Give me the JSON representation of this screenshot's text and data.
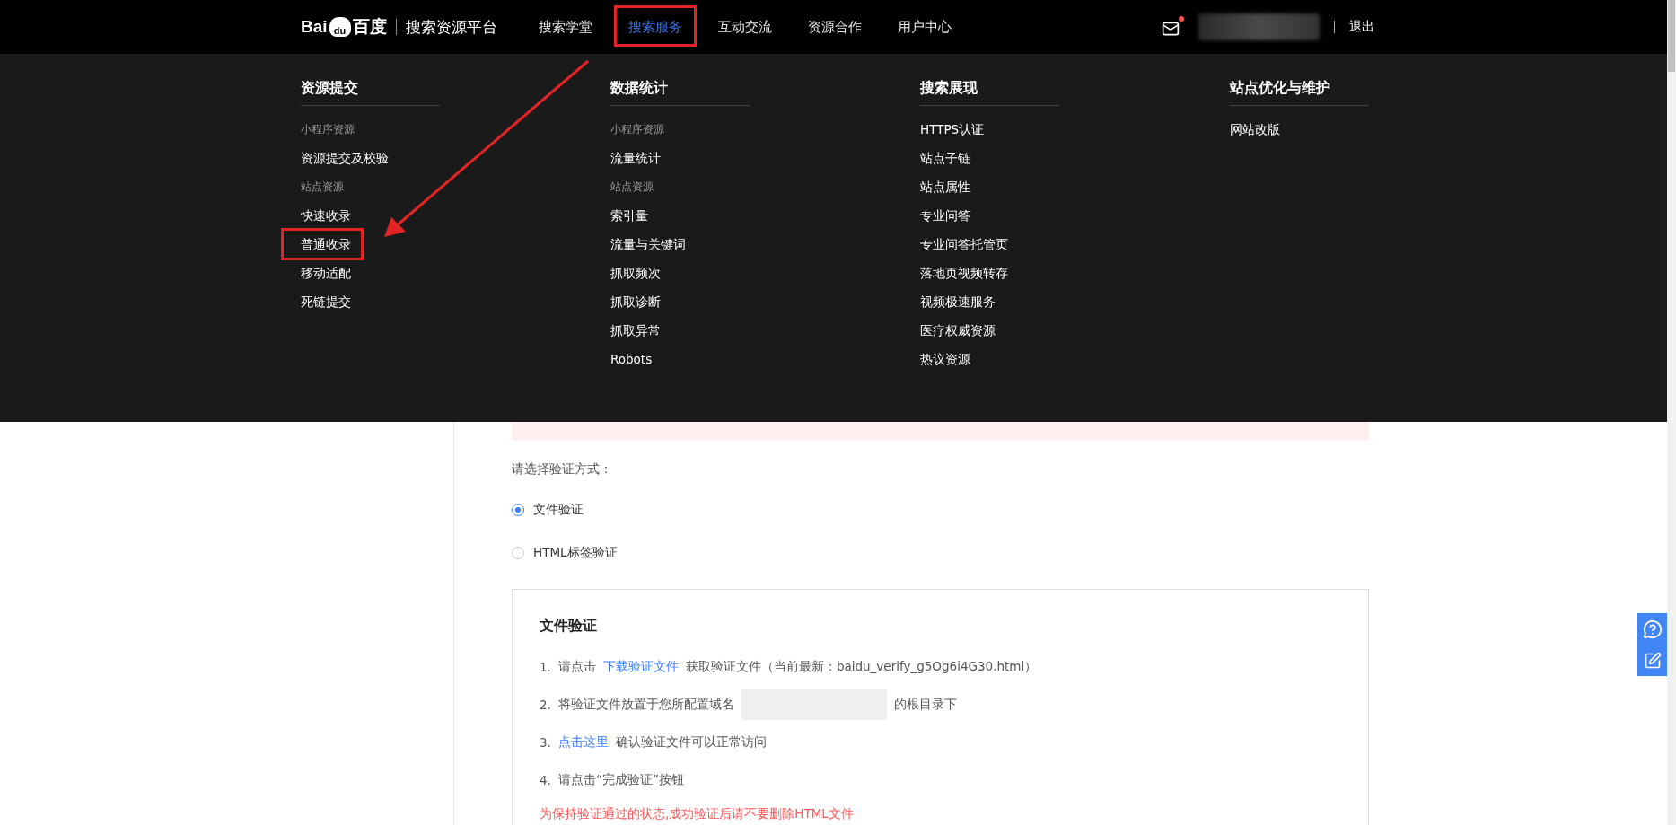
{
  "header": {
    "logo": {
      "left": "Bai",
      "paw": "du",
      "right": "百度"
    },
    "platform": "搜索资源平台",
    "nav": [
      {
        "label": "搜索学堂",
        "selected": false,
        "highlighted": false
      },
      {
        "label": "搜索服务",
        "selected": true,
        "highlighted": true
      },
      {
        "label": "互动交流",
        "selected": false,
        "highlighted": false
      },
      {
        "label": "资源合作",
        "selected": false,
        "highlighted": false
      },
      {
        "label": "用户中心",
        "selected": false,
        "highlighted": false
      }
    ],
    "mail_unread": true,
    "user_redacted": true,
    "logout": "退出"
  },
  "dropdown": {
    "columns": [
      {
        "heading": "资源提交",
        "items": [
          {
            "kind": "section",
            "label": "小程序资源",
            "highlighted": false
          },
          {
            "kind": "link",
            "label": "资源提交及校验",
            "highlighted": false
          },
          {
            "kind": "section",
            "label": "站点资源",
            "highlighted": false
          },
          {
            "kind": "link",
            "label": "快速收录",
            "highlighted": false
          },
          {
            "kind": "link",
            "label": "普通收录",
            "highlighted": true
          },
          {
            "kind": "link",
            "label": "移动适配",
            "highlighted": false
          },
          {
            "kind": "link",
            "label": "死链提交",
            "highlighted": false
          }
        ]
      },
      {
        "heading": "数据统计",
        "items": [
          {
            "kind": "section",
            "label": "小程序资源",
            "highlighted": false
          },
          {
            "kind": "link",
            "label": "流量统计",
            "highlighted": false
          },
          {
            "kind": "section",
            "label": "站点资源",
            "highlighted": false
          },
          {
            "kind": "link",
            "label": "索引量",
            "highlighted": false
          },
          {
            "kind": "link",
            "label": "流量与关键词",
            "highlighted": false
          },
          {
            "kind": "link",
            "label": "抓取频次",
            "highlighted": false
          },
          {
            "kind": "link",
            "label": "抓取诊断",
            "highlighted": false
          },
          {
            "kind": "link",
            "label": "抓取异常",
            "highlighted": false
          },
          {
            "kind": "link",
            "label": "Robots",
            "highlighted": false
          }
        ]
      },
      {
        "heading": "搜索展现",
        "items": [
          {
            "kind": "link",
            "label": "HTTPS认证",
            "highlighted": false
          },
          {
            "kind": "link",
            "label": "站点子链",
            "highlighted": false
          },
          {
            "kind": "link",
            "label": "站点属性",
            "highlighted": false
          },
          {
            "kind": "link",
            "label": "专业问答",
            "highlighted": false
          },
          {
            "kind": "link",
            "label": "专业问答托管页",
            "highlighted": false
          },
          {
            "kind": "link",
            "label": "落地页视频转存",
            "highlighted": false
          },
          {
            "kind": "link",
            "label": "视频极速服务",
            "highlighted": false
          },
          {
            "kind": "link",
            "label": "医疗权威资源",
            "highlighted": false
          },
          {
            "kind": "link",
            "label": "热议资源",
            "highlighted": false
          }
        ]
      },
      {
        "heading": "站点优化与维护",
        "items": [
          {
            "kind": "link",
            "label": "网站改版",
            "highlighted": false
          }
        ]
      }
    ]
  },
  "verify": {
    "prompt": "请选择验证方式：",
    "methods": [
      {
        "label": "文件验证",
        "selected": true
      },
      {
        "label": "HTML标签验证",
        "selected": false
      }
    ],
    "panel": {
      "title": "文件验证",
      "steps": [
        {
          "number": "1.",
          "parts": [
            {
              "kind": "text",
              "text": "请点击"
            },
            {
              "kind": "link",
              "text": "下载验证文件"
            },
            {
              "kind": "text",
              "text": "获取验证文件（当前最新：baidu_verify_g5Og6i4G30.html）"
            }
          ]
        },
        {
          "number": "2.",
          "parts": [
            {
              "kind": "text",
              "text": "将验证文件放置于您所配置域名"
            },
            {
              "kind": "redacted"
            },
            {
              "kind": "text",
              "text": "的根目录下"
            }
          ]
        },
        {
          "number": "3.",
          "parts": [
            {
              "kind": "link",
              "text": "点击这里"
            },
            {
              "kind": "text",
              "text": "确认验证文件可以正常访问"
            }
          ]
        },
        {
          "number": "4.",
          "parts": [
            {
              "kind": "text",
              "text": "请点击“完成验证”按钮"
            }
          ]
        }
      ],
      "note": "为保持验证通过的状态,成功验证后请不要删除HTML文件"
    }
  }
}
